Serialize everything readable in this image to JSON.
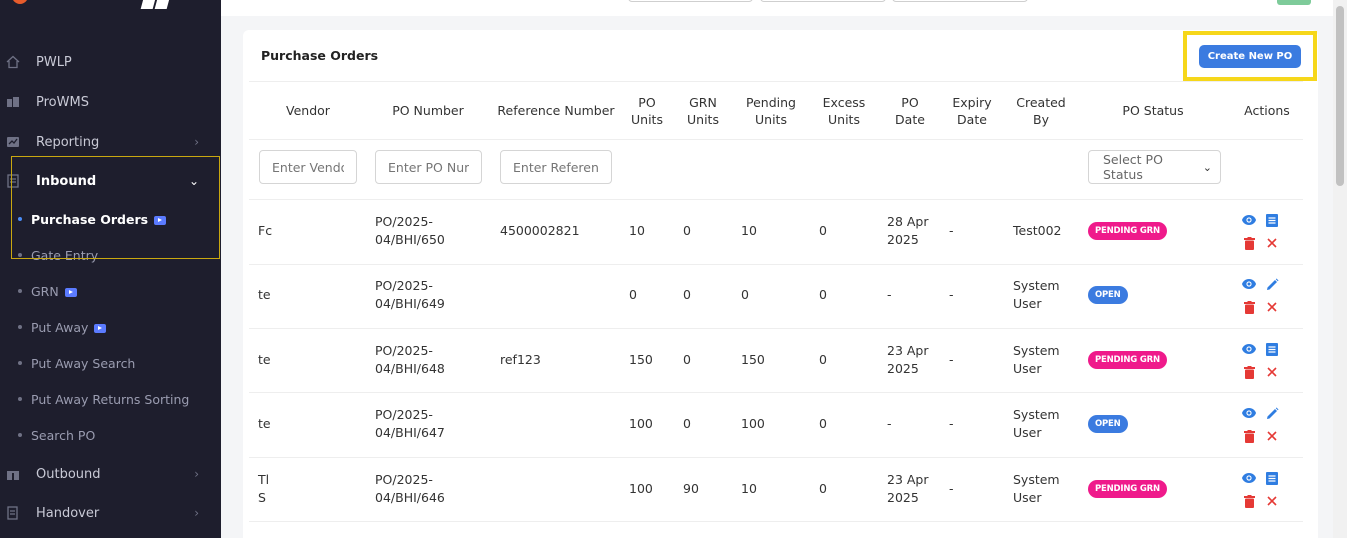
{
  "sidebar": {
    "items": [
      {
        "label": "PWLP",
        "icon": "home-icon"
      },
      {
        "label": "ProWMS",
        "icon": "boxes-icon"
      },
      {
        "label": "Reporting",
        "icon": "chart-icon"
      },
      {
        "label": "Inbound",
        "icon": "inbound-icon"
      },
      {
        "label": "Outbound",
        "icon": "gift-icon"
      },
      {
        "label": "Handover",
        "icon": "document-icon"
      }
    ],
    "sub_items": [
      {
        "label": "Purchase Orders",
        "video": true
      },
      {
        "label": "Gate Entry",
        "video": false
      },
      {
        "label": "GRN",
        "video": true
      },
      {
        "label": "Put Away",
        "video": true
      },
      {
        "label": "Put Away Search",
        "video": false
      },
      {
        "label": "Put Away Returns Sorting",
        "video": false
      },
      {
        "label": "Search PO",
        "video": false
      }
    ]
  },
  "card": {
    "title": "Purchase Orders",
    "create_button": "Create New PO"
  },
  "table": {
    "headers": {
      "vendor": "Vendor",
      "po_number": "PO Number",
      "reference_number": "Reference Number",
      "po_units_1": "PO",
      "po_units_2": "Units",
      "grn_units_1": "GRN",
      "grn_units_2": "Units",
      "pending_units_1": "Pending",
      "pending_units_2": "Units",
      "excess_units_1": "Excess",
      "excess_units_2": "Units",
      "po_date_1": "PO",
      "po_date_2": "Date",
      "expiry_date_1": "Expiry",
      "expiry_date_2": "Date",
      "created_by_1": "Created",
      "created_by_2": "By",
      "po_status": "PO Status",
      "actions": "Actions"
    },
    "filters": {
      "vendor_placeholder": "Enter Vendor",
      "po_number_placeholder": "Enter PO Number",
      "reference_placeholder": "Enter Reference",
      "status_placeholder": "Select PO Status"
    },
    "rows": [
      {
        "vendor": "Fc",
        "po_1": "PO/2025-",
        "po_2": "04/BHI/650",
        "ref": "4500002821",
        "po_units": "10",
        "grn_units": "0",
        "pending": "10",
        "excess": "0",
        "date_1": "28 Apr",
        "date_2": "2025",
        "expiry": "-",
        "created_1": "Test002",
        "created_2": "",
        "status": "PENDING GRN",
        "status_type": "pending",
        "edit_icon": "list-icon"
      },
      {
        "vendor": "te",
        "po_1": "PO/2025-",
        "po_2": "04/BHI/649",
        "ref": "",
        "po_units": "0",
        "grn_units": "0",
        "pending": "0",
        "excess": "0",
        "date_1": "-",
        "date_2": "",
        "expiry": "-",
        "created_1": "System",
        "created_2": "User",
        "status": "OPEN",
        "status_type": "open",
        "edit_icon": "pencil-icon"
      },
      {
        "vendor": "te",
        "po_1": "PO/2025-",
        "po_2": "04/BHI/648",
        "ref": "ref123",
        "po_units": "150",
        "grn_units": "0",
        "pending": "150",
        "excess": "0",
        "date_1": "23 Apr",
        "date_2": "2025",
        "expiry": "-",
        "created_1": "System",
        "created_2": "User",
        "status": "PENDING GRN",
        "status_type": "pending",
        "edit_icon": "list-icon"
      },
      {
        "vendor": "te",
        "po_1": "PO/2025-",
        "po_2": "04/BHI/647",
        "ref": "",
        "po_units": "100",
        "grn_units": "0",
        "pending": "100",
        "excess": "0",
        "date_1": "-",
        "date_2": "",
        "expiry": "-",
        "created_1": "System",
        "created_2": "User",
        "status": "OPEN",
        "status_type": "open",
        "edit_icon": "pencil-icon"
      },
      {
        "vendor": "Tl",
        "vendor_2": "S",
        "po_1": "PO/2025-",
        "po_2": "04/BHI/646",
        "ref": "",
        "po_units": "100",
        "grn_units": "90",
        "pending": "10",
        "excess": "0",
        "date_1": "23 Apr",
        "date_2": "2025",
        "expiry": "-",
        "created_1": "System",
        "created_2": "User",
        "status": "PENDING GRN",
        "status_type": "pending",
        "edit_icon": "list-icon"
      }
    ]
  },
  "colors": {
    "sidebar_bg": "#1e1e2d",
    "accent_blue": "#3b7be0",
    "pending_pink": "#ef1a8b",
    "delete_red": "#e53935",
    "highlight_yellow": "#f6d71a"
  }
}
